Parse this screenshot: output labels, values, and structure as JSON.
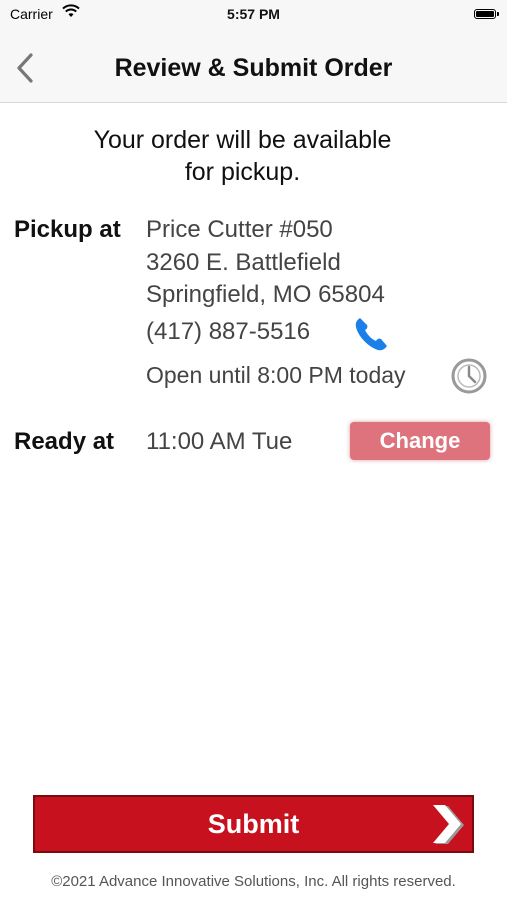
{
  "status_bar": {
    "carrier": "Carrier",
    "time": "5:57 PM"
  },
  "nav": {
    "title": "Review & Submit Order"
  },
  "intro": {
    "line1": "Your order will be available",
    "line2": "for pickup."
  },
  "pickup": {
    "label": "Pickup at",
    "store_name": "Price Cutter #050",
    "address_line1": "3260 E. Battlefield",
    "address_line2": "Springfield, MO 65804",
    "phone": "(417) 887-5516",
    "hours": "Open until 8:00 PM today"
  },
  "ready": {
    "label": "Ready at",
    "time": "11:00 AM Tue",
    "change_label": "Change"
  },
  "submit": {
    "label": "Submit"
  },
  "footer": {
    "copyright": "©2021 Advance Innovative Solutions, Inc. All rights reserved."
  },
  "colors": {
    "primary_red": "#c8111e",
    "change_pink": "#de737e",
    "phone_blue": "#1a7fe8"
  },
  "icons": [
    "wifi-icon",
    "battery-icon",
    "back-chevron-icon",
    "phone-icon",
    "clock-icon",
    "chevron-right-icon"
  ]
}
